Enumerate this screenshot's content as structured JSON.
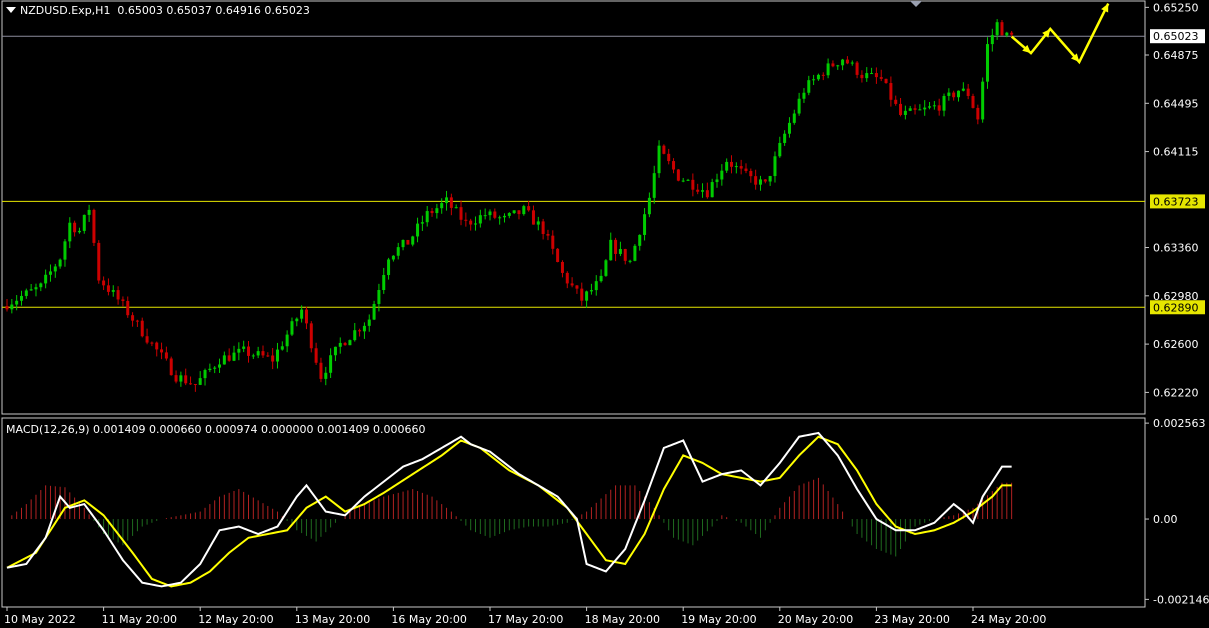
{
  "header": {
    "symbol_line": "NZDUSD.Exp,H1  0.65003 0.65037 0.64916 0.65023",
    "macd_line": "MACD(12,26,9) 0.001409 0.000660 0.000974 0.000000 0.001409 0.000660"
  },
  "colors": {
    "background": "#000000",
    "bull_candle": "#00cc00",
    "bear_candle": "#cc0000",
    "level_line": "#e6e600",
    "projection_arrow": "#ffff00",
    "macd_line": "#ffffff",
    "signal_line": "#ffff00",
    "hist_positive": "#b22222",
    "hist_negative": "#1f6b1f",
    "axis_text": "#ffffff",
    "frame": "#c8c8c8"
  },
  "chart_data": {
    "type": "candlestick",
    "symbol": "NZDUSD.Exp",
    "timeframe": "H1",
    "price_axis": {
      "ylim": [
        0.6205,
        0.653
      ],
      "ticks": [
        "0.65250",
        "0.64875",
        "0.64495",
        "0.64115",
        "0.63360",
        "0.62980",
        "0.62600",
        "0.62220"
      ],
      "tick_values": [
        0.6525,
        0.64875,
        0.64495,
        0.64115,
        0.6336,
        0.6298,
        0.626,
        0.6222
      ]
    },
    "current_price": {
      "label": "0.65023",
      "value": 0.65023
    },
    "horizontal_levels": [
      {
        "label": "0.63723",
        "value": 0.63723
      },
      {
        "label": "0.62890",
        "value": 0.6289
      }
    ],
    "time_axis": {
      "labels": [
        "10 May 2022",
        "11 May 20:00",
        "12 May 20:00",
        "13 May 20:00",
        "16 May 20:00",
        "17 May 20:00",
        "18 May 20:00",
        "19 May 20:00",
        "20 May 20:00",
        "23 May 20:00",
        "24 May 20:00"
      ],
      "label_bar_index": [
        0,
        20,
        40,
        60,
        80,
        100,
        120,
        140,
        160,
        180,
        200
      ]
    },
    "bars_count": 205,
    "price_path": [
      [
        0,
        0.629
      ],
      [
        8,
        0.6305
      ],
      [
        12,
        0.6328
      ],
      [
        14,
        0.6355
      ],
      [
        16,
        0.6349
      ],
      [
        18,
        0.6367
      ],
      [
        20,
        0.6312
      ],
      [
        24,
        0.6295
      ],
      [
        28,
        0.6275
      ],
      [
        32,
        0.6255
      ],
      [
        36,
        0.6235
      ],
      [
        40,
        0.6228
      ],
      [
        45,
        0.6248
      ],
      [
        50,
        0.6254
      ],
      [
        56,
        0.6248
      ],
      [
        62,
        0.6287
      ],
      [
        66,
        0.6235
      ],
      [
        70,
        0.626
      ],
      [
        76,
        0.628
      ],
      [
        80,
        0.633
      ],
      [
        84,
        0.634
      ],
      [
        88,
        0.6362
      ],
      [
        92,
        0.6372
      ],
      [
        96,
        0.6355
      ],
      [
        100,
        0.6362
      ],
      [
        104,
        0.6358
      ],
      [
        108,
        0.6365
      ],
      [
        112,
        0.635
      ],
      [
        116,
        0.6315
      ],
      [
        120,
        0.6295
      ],
      [
        124,
        0.631
      ],
      [
        126,
        0.6338
      ],
      [
        130,
        0.6325
      ],
      [
        134,
        0.6375
      ],
      [
        136,
        0.6412
      ],
      [
        140,
        0.6392
      ],
      [
        146,
        0.638
      ],
      [
        150,
        0.6405
      ],
      [
        154,
        0.6392
      ],
      [
        158,
        0.6385
      ],
      [
        162,
        0.6425
      ],
      [
        166,
        0.646
      ],
      [
        170,
        0.6475
      ],
      [
        174,
        0.6485
      ],
      [
        178,
        0.6472
      ],
      [
        182,
        0.6468
      ],
      [
        186,
        0.644
      ],
      [
        190,
        0.6443
      ],
      [
        194,
        0.6448
      ],
      [
        198,
        0.646
      ],
      [
        200,
        0.6457
      ],
      [
        202,
        0.6438
      ],
      [
        204,
        0.6495
      ],
      [
        206,
        0.6512
      ],
      [
        208,
        0.6502
      ]
    ],
    "projection_path": [
      {
        "bar": 208,
        "price": 0.6502
      },
      {
        "bar": 212,
        "price": 0.6489
      },
      {
        "bar": 216,
        "price": 0.6508
      },
      {
        "bar": 222,
        "price": 0.6482
      },
      {
        "bar": 228,
        "price": 0.6528
      }
    ],
    "macd": {
      "params": "MACD(12,26,9)",
      "ylim": [
        -0.00235,
        0.0027
      ],
      "ticks": [
        "0.002563",
        "0.00",
        "-0.002146"
      ],
      "tick_values": [
        0.002563,
        0.0,
        -0.002146
      ],
      "histogram_path": [
        [
          0,
          0.0
        ],
        [
          4,
          0.0004
        ],
        [
          8,
          0.0009
        ],
        [
          12,
          0.00085
        ],
        [
          16,
          0.0003
        ],
        [
          20,
          -0.0004
        ],
        [
          24,
          -0.0007
        ],
        [
          28,
          -0.0002
        ],
        [
          32,
          0.0
        ],
        [
          40,
          0.0002
        ],
        [
          44,
          0.0006
        ],
        [
          48,
          0.0008
        ],
        [
          52,
          0.0005
        ],
        [
          56,
          0.0002
        ],
        [
          60,
          -0.0003
        ],
        [
          64,
          -0.0006
        ],
        [
          68,
          -0.0001
        ],
        [
          72,
          0.0003
        ],
        [
          78,
          0.0006
        ],
        [
          84,
          0.0008
        ],
        [
          88,
          0.0006
        ],
        [
          92,
          0.0002
        ],
        [
          96,
          -0.0003
        ],
        [
          100,
          -0.0005
        ],
        [
          104,
          -0.0003
        ],
        [
          108,
          -0.0002
        ],
        [
          112,
          -0.0002
        ],
        [
          116,
          -0.0001
        ],
        [
          120,
          0.0002
        ],
        [
          126,
          0.0009
        ],
        [
          130,
          0.0009
        ],
        [
          134,
          0.0003
        ],
        [
          138,
          -0.0005
        ],
        [
          142,
          -0.0007
        ],
        [
          146,
          -0.0002
        ],
        [
          148,
          0.0001
        ],
        [
          152,
          -0.0001
        ],
        [
          156,
          -0.0005
        ],
        [
          160,
          0.0003
        ],
        [
          164,
          0.0009
        ],
        [
          168,
          0.0011
        ],
        [
          172,
          0.0004
        ],
        [
          176,
          -0.0004
        ],
        [
          180,
          -0.0008
        ],
        [
          184,
          -0.001
        ],
        [
          188,
          -0.0002
        ],
        [
          192,
          0.0
        ],
        [
          196,
          0.0001
        ],
        [
          200,
          0.0003
        ],
        [
          206,
          0.00097
        ]
      ],
      "macd_path": [
        [
          0,
          -0.0013
        ],
        [
          4,
          -0.0012
        ],
        [
          8,
          -0.0005
        ],
        [
          11,
          0.0006
        ],
        [
          13,
          0.0003
        ],
        [
          16,
          0.0004
        ],
        [
          20,
          -0.0003
        ],
        [
          24,
          -0.0011
        ],
        [
          28,
          -0.0017
        ],
        [
          32,
          -0.0018
        ],
        [
          36,
          -0.0017
        ],
        [
          40,
          -0.0012
        ],
        [
          44,
          -0.0003
        ],
        [
          48,
          -0.0002
        ],
        [
          52,
          -0.0004
        ],
        [
          56,
          -0.0002
        ],
        [
          60,
          0.0006
        ],
        [
          62,
          0.0009
        ],
        [
          66,
          0.0002
        ],
        [
          70,
          0.0001
        ],
        [
          74,
          0.0006
        ],
        [
          78,
          0.001
        ],
        [
          82,
          0.0014
        ],
        [
          86,
          0.0016
        ],
        [
          90,
          0.0019
        ],
        [
          94,
          0.0022
        ],
        [
          96,
          0.002
        ],
        [
          100,
          0.0018
        ],
        [
          106,
          0.0012
        ],
        [
          110,
          0.0009
        ],
        [
          114,
          0.0006
        ],
        [
          118,
          0.0
        ],
        [
          120,
          -0.0012
        ],
        [
          124,
          -0.0014
        ],
        [
          128,
          -0.0008
        ],
        [
          132,
          0.0005
        ],
        [
          136,
          0.0019
        ],
        [
          140,
          0.0021
        ],
        [
          144,
          0.001
        ],
        [
          148,
          0.0012
        ],
        [
          152,
          0.0013
        ],
        [
          156,
          0.0009
        ],
        [
          160,
          0.0015
        ],
        [
          164,
          0.0022
        ],
        [
          168,
          0.0023
        ],
        [
          172,
          0.0017
        ],
        [
          176,
          0.0008
        ],
        [
          180,
          0.0
        ],
        [
          184,
          -0.0003
        ],
        [
          188,
          -0.0003
        ],
        [
          192,
          -0.0001
        ],
        [
          196,
          0.0004
        ],
        [
          198,
          0.0002
        ],
        [
          200,
          -0.0001
        ],
        [
          202,
          0.0006
        ],
        [
          206,
          0.0014
        ]
      ],
      "signal_path": [
        [
          0,
          -0.0013
        ],
        [
          6,
          -0.0009
        ],
        [
          12,
          0.0003
        ],
        [
          16,
          0.0005
        ],
        [
          20,
          0.0001
        ],
        [
          26,
          -0.0009
        ],
        [
          30,
          -0.0016
        ],
        [
          34,
          -0.0018
        ],
        [
          38,
          -0.0017
        ],
        [
          42,
          -0.0014
        ],
        [
          46,
          -0.0009
        ],
        [
          50,
          -0.0005
        ],
        [
          54,
          -0.0004
        ],
        [
          58,
          -0.0003
        ],
        [
          62,
          0.0003
        ],
        [
          66,
          0.0006
        ],
        [
          70,
          0.0002
        ],
        [
          74,
          0.0004
        ],
        [
          78,
          0.0007
        ],
        [
          84,
          0.0012
        ],
        [
          90,
          0.0017
        ],
        [
          94,
          0.0021
        ],
        [
          98,
          0.0019
        ],
        [
          104,
          0.0013
        ],
        [
          110,
          0.0009
        ],
        [
          116,
          0.0003
        ],
        [
          120,
          -0.0004
        ],
        [
          124,
          -0.0011
        ],
        [
          128,
          -0.0012
        ],
        [
          132,
          -0.0004
        ],
        [
          136,
          0.0008
        ],
        [
          140,
          0.0017
        ],
        [
          144,
          0.0015
        ],
        [
          148,
          0.0012
        ],
        [
          152,
          0.0011
        ],
        [
          156,
          0.001
        ],
        [
          160,
          0.0011
        ],
        [
          164,
          0.0017
        ],
        [
          168,
          0.0022
        ],
        [
          172,
          0.002
        ],
        [
          176,
          0.0013
        ],
        [
          180,
          0.0004
        ],
        [
          184,
          -0.0002
        ],
        [
          188,
          -0.0004
        ],
        [
          192,
          -0.0003
        ],
        [
          196,
          -0.0001
        ],
        [
          200,
          0.0002
        ],
        [
          204,
          0.0006
        ],
        [
          206,
          0.0009
        ]
      ]
    }
  }
}
